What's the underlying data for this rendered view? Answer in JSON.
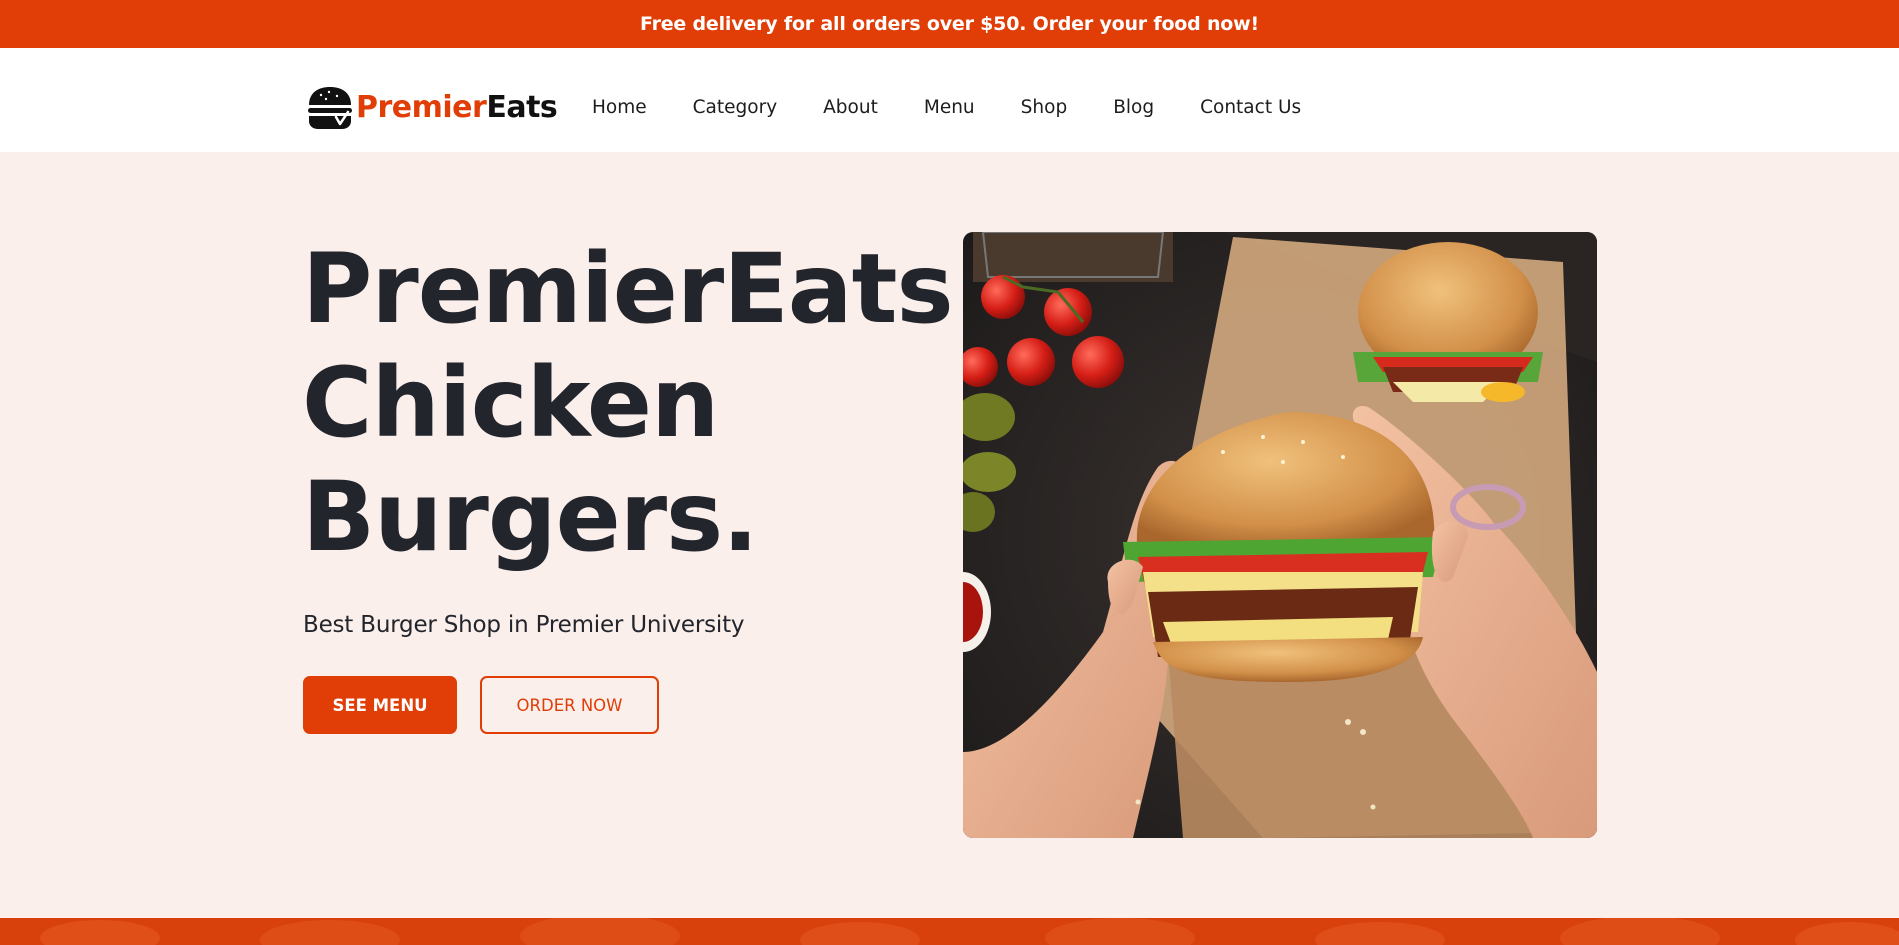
{
  "promo": {
    "text": "Free delivery for all orders over $50. Order your food now!"
  },
  "brand": {
    "part_a": "Premier",
    "part_b": "Eats",
    "icon": "burger-icon",
    "accent_color": "#e03d07",
    "dark_color": "#111111"
  },
  "nav": {
    "items": [
      {
        "label": "Home"
      },
      {
        "label": "Category"
      },
      {
        "label": "About"
      },
      {
        "label": "Menu"
      },
      {
        "label": "Shop"
      },
      {
        "label": "Blog"
      },
      {
        "label": "Contact Us"
      }
    ]
  },
  "hero": {
    "title_lines": [
      "PremierEats",
      "Chicken",
      "Burgers."
    ],
    "subtitle": "Best Burger Shop in Premier University",
    "primary_button": "SEE MENU",
    "secondary_button": "ORDER NOW",
    "image": "hands-holding-burger-photo"
  },
  "colors": {
    "accent": "#e03d07",
    "background": "#fbefec",
    "text": "#22252b"
  }
}
